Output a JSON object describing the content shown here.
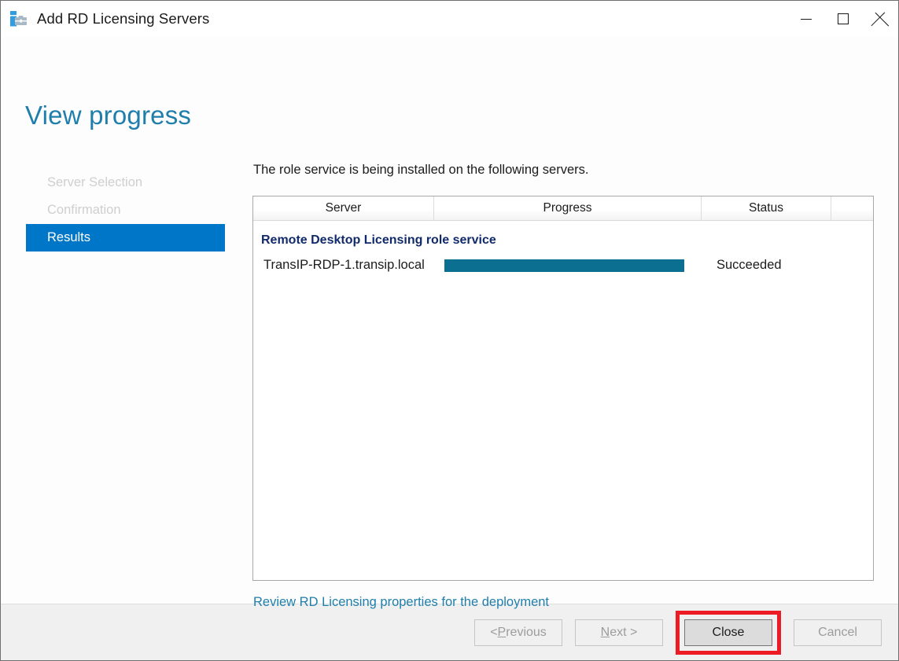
{
  "window": {
    "title": "Add RD Licensing Servers",
    "icon": "rd-licensing-server-icon",
    "controls": {
      "minimize": "minimize-icon",
      "maximize": "maximize-icon",
      "close": "close-icon"
    }
  },
  "page": {
    "heading": "View progress"
  },
  "steps": [
    {
      "label": "Server Selection",
      "state": "completed"
    },
    {
      "label": "Confirmation",
      "state": "completed"
    },
    {
      "label": "Results",
      "state": "active"
    }
  ],
  "main": {
    "instruction": "The role service is being installed on the following servers.",
    "table": {
      "columns": [
        "Server",
        "Progress",
        "Status",
        ""
      ],
      "group_header": "Remote Desktop Licensing role service",
      "rows": [
        {
          "server": "TransIP-RDP-1.transip.local",
          "progress_percent": 100,
          "status": "Succeeded"
        }
      ]
    },
    "review_link": "Review RD Licensing properties for the deployment"
  },
  "footer": {
    "buttons": [
      {
        "label_prefix": "< ",
        "accel": "P",
        "label_suffix": "revious",
        "enabled": false
      },
      {
        "label_prefix": "",
        "accel": "N",
        "label_suffix": "ext >",
        "enabled": false
      },
      {
        "label": "Close",
        "enabled": true,
        "highlighted": true
      },
      {
        "label": "Cancel",
        "enabled": false
      }
    ]
  },
  "colors": {
    "accent_blue": "#0076c8",
    "title_teal": "#1f7eac",
    "progress_teal": "#0a6f90",
    "group_navy": "#102a6b",
    "highlight_red": "#ed1c24",
    "footer_gray": "#f0f0f0"
  }
}
